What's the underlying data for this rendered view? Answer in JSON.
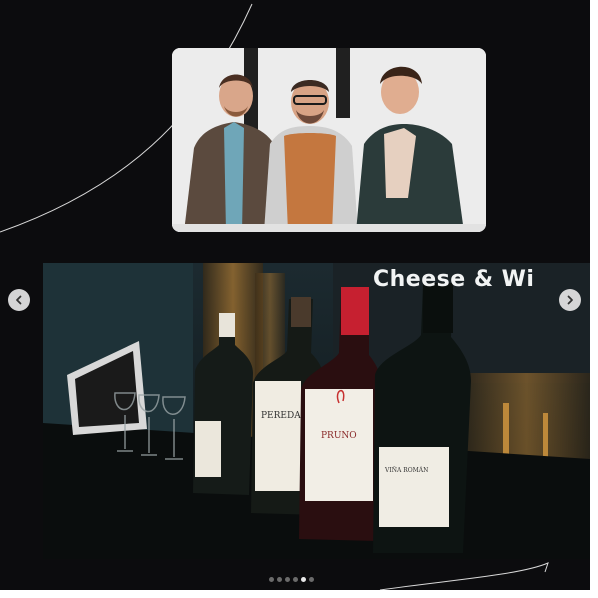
{
  "colors": {
    "background": "#0c0c0e",
    "dot_inactive": "#6b6b6b",
    "dot_active": "#e8e8e8",
    "arrow_bg": "#e6e6e6"
  },
  "gallery": {
    "top_photo": {
      "description_icon": "people-photo-icon"
    },
    "bottom_photo": {
      "banner_text": "Cheese & Wi",
      "bottle_labels": [
        "PEREDA",
        "PRUNO",
        "VIÑA ROMÁN"
      ]
    },
    "nav": {
      "prev_icon": "chevron-left-icon",
      "next_icon": "chevron-right-icon"
    },
    "pagination": {
      "count": 6,
      "active_index": 4
    }
  }
}
